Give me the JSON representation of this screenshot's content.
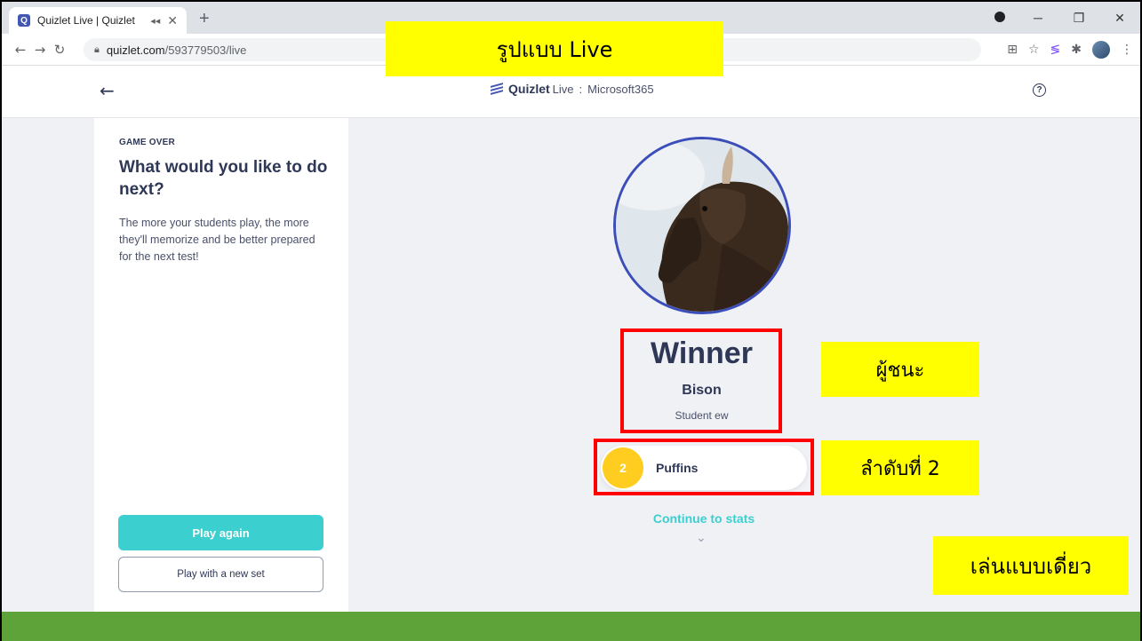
{
  "browser": {
    "tab_title": "Quizlet Live | Quizlet",
    "tab_favicon": "Q",
    "new_tab": "+",
    "url_host": "quizlet.com",
    "url_path": "/593779503/live"
  },
  "header": {
    "brand_name": "Quizlet",
    "brand_product": "Live",
    "separator": ":",
    "set_name": "Microsoft365"
  },
  "left_panel": {
    "eyebrow": "GAME OVER",
    "heading": "What would you like to do next?",
    "description": "The more your students play, the more they'll memorize and be better prepared for the next test!",
    "primary_button": "Play again",
    "secondary_button": "Play with a new set"
  },
  "result": {
    "winner_title": "Winner",
    "winner_team": "Bison",
    "winner_member": "Student ew",
    "second_rank": "2",
    "second_team": "Puffins",
    "continue_label": "Continue to stats"
  },
  "annotations": {
    "top_label": "รูปแบบ Live",
    "winner_label": "ผู้ชนะ",
    "second_label": "ลำดับที่ 2",
    "mode_label": "เล่นแบบเดี่ยว"
  },
  "colors": {
    "brand_navy": "#2e3856",
    "teal": "#3ccfcf",
    "rank_yellow": "#ffcd1f",
    "annotation_red": "#ff0000",
    "annotation_yellow": "#ffff00",
    "footer_green": "#5da33a"
  }
}
